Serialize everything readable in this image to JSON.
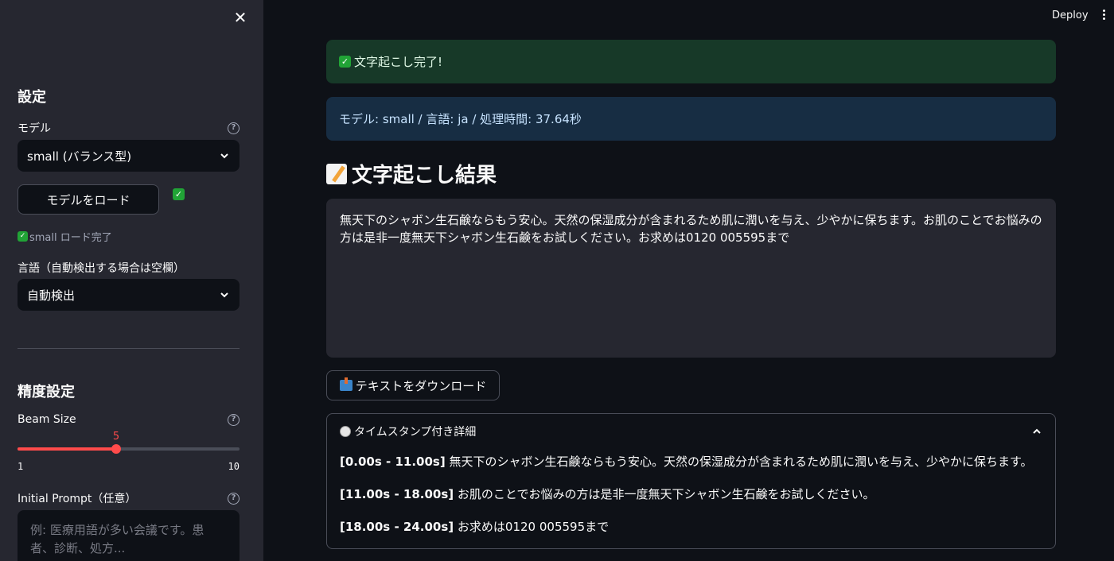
{
  "sidebar": {
    "settings_heading": "設定",
    "model_label": "モデル",
    "model_selected": "small (バランス型)",
    "load_button": "モデルをロード",
    "load_status": "small ロード完了",
    "language_label": "言語（自動検出する場合は空欄）",
    "language_selected": "自動検出",
    "precision_heading": "精度設定",
    "beam_label": "Beam Size",
    "beam_value": "5",
    "beam_min": "1",
    "beam_max": "10",
    "beam_fraction": 0.444,
    "prompt_label": "Initial Prompt（任意）",
    "prompt_placeholder": "例: 医療用語が多い会議です。患者、診断、処方..."
  },
  "topbar": {
    "deploy_label": "Deploy"
  },
  "main": {
    "success_message": "文字起こし完了!",
    "info_message": "モデル: small / 言語: ja / 処理時間: 37.64秒",
    "result_title": "文字起こし結果",
    "result_text": "無天下のシャボン生石鹸ならもう安心。天然の保湿成分が含まれるため肌に潤いを与え、少やかに保ちます。お肌のことでお悩みの方は是非一度無天下シャボン生石鹸をお試しください。お求めは0120 005595まで",
    "download_button": "テキストをダウンロード",
    "expander_title": "タイムスタンプ付き詳細",
    "segments": [
      {
        "time": "[0.00s - 11.00s]",
        "text": "無天下のシャボン生石鹸ならもう安心。天然の保湿成分が含まれるため肌に潤いを与え、少やかに保ちます。"
      },
      {
        "time": "[11.00s - 18.00s]",
        "text": "お肌のことでお悩みの方は是非一度無天下シャボン生石鹸をお試しください。"
      },
      {
        "time": "[18.00s - 24.00s]",
        "text": "お求めは0120 005595まで"
      }
    ]
  },
  "colors": {
    "accent": "#ff4b4b",
    "success_bg": "#173928",
    "info_bg": "#172d43",
    "check_green": "#21a336"
  },
  "icons": {
    "check": "white-check-mark-icon",
    "memo": "memo-icon",
    "download": "inbox-tray-icon",
    "timestamp": "clock-icon"
  }
}
